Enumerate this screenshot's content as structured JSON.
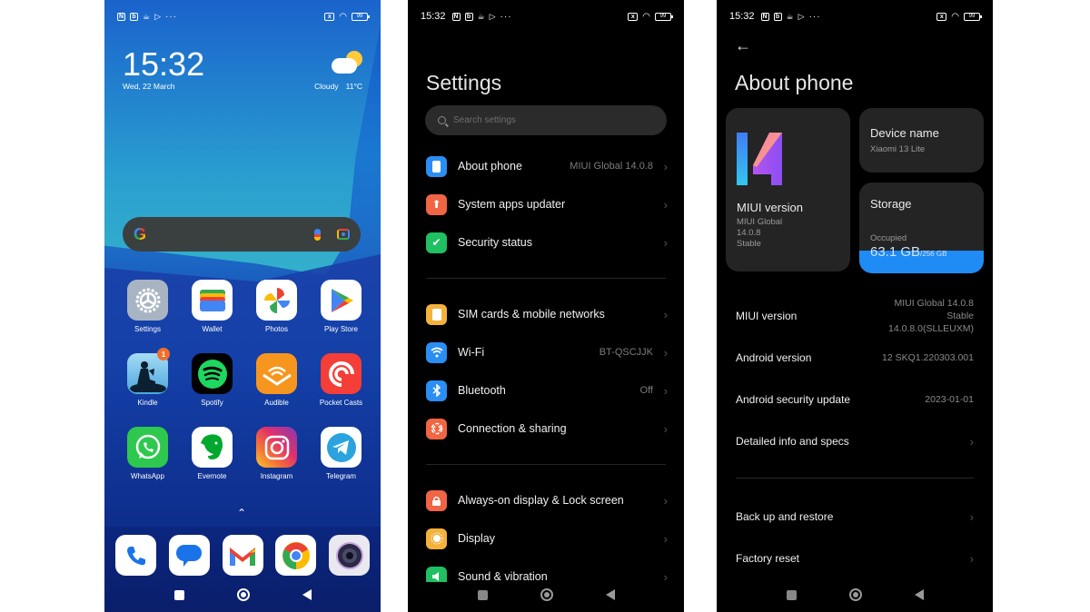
{
  "status_bar": {
    "time": "15:32",
    "notification_icons": [
      "nfc-icon",
      "b-icon",
      "cup-icon",
      "play-icon"
    ],
    "more": "···",
    "battery": "99"
  },
  "home": {
    "clock": "15:32",
    "date": "Wed, 22 March",
    "weather": {
      "condition": "Cloudy",
      "temp": "11°C"
    },
    "search_bar": {
      "logo": "G"
    },
    "apps": [
      {
        "label": "Settings",
        "icon": "settings-icon",
        "bg": "#a9b4c2"
      },
      {
        "label": "Wallet",
        "icon": "wallet-icon",
        "bg": "#ffffff"
      },
      {
        "label": "Photos",
        "icon": "photos-icon",
        "bg": "#ffffff"
      },
      {
        "label": "Play Store",
        "icon": "play-store-icon",
        "bg": "#ffffff"
      },
      {
        "label": "Kindle",
        "icon": "kindle-icon",
        "bg": "#7ec4ec",
        "badge": "1"
      },
      {
        "label": "Spotify",
        "icon": "spotify-icon",
        "bg": "#000000"
      },
      {
        "label": "Audible",
        "icon": "audible-icon",
        "bg": "#f7961e"
      },
      {
        "label": "Pocket Casts",
        "icon": "pocket-casts-icon",
        "bg": "#f43e37"
      },
      {
        "label": "WhatsApp",
        "icon": "whatsapp-icon",
        "bg": "#2dc84d"
      },
      {
        "label": "Evernote",
        "icon": "evernote-icon",
        "bg": "#ffffff"
      },
      {
        "label": "Instagram",
        "icon": "instagram-icon",
        "bg": "#d6249f"
      },
      {
        "label": "Telegram",
        "icon": "telegram-icon",
        "bg": "#ffffff"
      }
    ],
    "dock": [
      {
        "name": "phone",
        "icon": "phone-icon"
      },
      {
        "name": "messages",
        "icon": "messages-icon"
      },
      {
        "name": "gmail",
        "icon": "gmail-icon"
      },
      {
        "name": "chrome",
        "icon": "chrome-icon"
      },
      {
        "name": "camera",
        "icon": "camera-icon"
      }
    ]
  },
  "settings": {
    "title": "Settings",
    "search_placeholder": "Search settings",
    "items": [
      {
        "label": "About phone",
        "value": "MIUI Global 14.0.8",
        "icon": "phone-info-icon",
        "color": "#2b8ef3"
      },
      {
        "label": "System apps updater",
        "value": "",
        "icon": "arrow-up-icon",
        "color": "#f06543"
      },
      {
        "label": "Security status",
        "value": "",
        "icon": "shield-check-icon",
        "color": "#1fbf62"
      },
      {
        "label": "SIM cards & mobile networks",
        "value": "",
        "icon": "sim-card-icon",
        "color": "#f3b23c"
      },
      {
        "label": "Wi-Fi",
        "value": "BT-QSCJJK",
        "icon": "wifi-icon",
        "color": "#2b8ef3"
      },
      {
        "label": "Bluetooth",
        "value": "Off",
        "icon": "bluetooth-icon",
        "color": "#2b8ef3"
      },
      {
        "label": "Connection & sharing",
        "value": "",
        "icon": "connection-icon",
        "color": "#f06543"
      },
      {
        "label": "Always-on display & Lock screen",
        "value": "",
        "icon": "lock-icon",
        "color": "#f06543"
      },
      {
        "label": "Display",
        "value": "",
        "icon": "sun-icon",
        "color": "#f3b23c"
      },
      {
        "label": "Sound & vibration",
        "value": "",
        "icon": "sound-icon",
        "color": "#1fbf62"
      }
    ]
  },
  "about": {
    "title": "About phone",
    "miui_card": {
      "title": "MIUI version",
      "lines": [
        "MIUI Global",
        "14.0.8",
        "Stable"
      ]
    },
    "device_card": {
      "title": "Device name",
      "value": "Xiaomi 13 Lite"
    },
    "storage_card": {
      "title": "Storage",
      "label": "Occupied",
      "used": "63.1 GB",
      "total": "/256 GB",
      "used_fraction": 0.25
    },
    "rows": [
      {
        "label": "MIUI version",
        "value": [
          "MIUI Global 14.0.8",
          "Stable",
          "14.0.8.0(SLLEUXM)"
        ]
      },
      {
        "label": "Android version",
        "value": [
          "12 SKQ1.220303.001"
        ]
      },
      {
        "label": "Android security update",
        "value": [
          "2023-01-01"
        ]
      },
      {
        "label": "Detailed info and specs",
        "value": [],
        "chevron": true
      },
      {
        "label": "Back up and restore",
        "value": [],
        "chevron": true
      },
      {
        "label": "Factory reset",
        "value": [],
        "chevron": true
      }
    ]
  },
  "colors": {
    "accent_blue": "#1f8bf4",
    "dark_card": "#242424"
  }
}
